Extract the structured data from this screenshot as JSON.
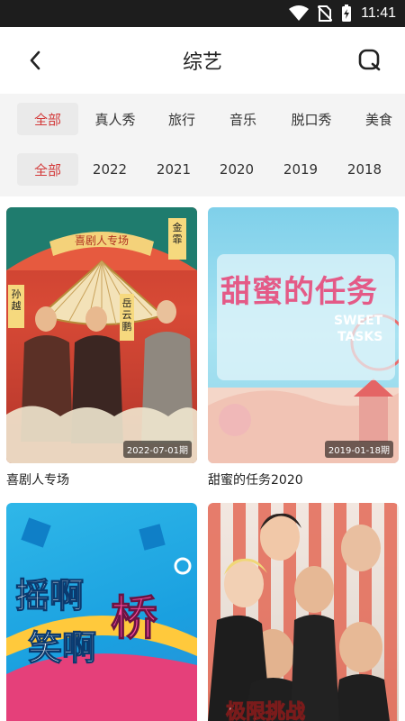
{
  "status": {
    "time": "11:41"
  },
  "header": {
    "title": "综艺"
  },
  "filters": {
    "categories": [
      "全部",
      "真人秀",
      "旅行",
      "音乐",
      "脱口秀",
      "美食"
    ],
    "years": [
      "全部",
      "2022",
      "2021",
      "2020",
      "2019",
      "2018"
    ]
  },
  "cards": [
    {
      "title": "喜剧人专场",
      "date": "2022-07-01期"
    },
    {
      "title": "甜蜜的任务2020",
      "date": "2019-01-18期"
    },
    {
      "title": "",
      "date": ""
    },
    {
      "title": "",
      "date": ""
    }
  ],
  "poster_text": {
    "card0_banner": "喜剧人专场",
    "card0_left_sign": "孙越",
    "card0_right_sign": "岳云鹏",
    "card0_top_right_sign": "金霏",
    "card1_cn": "甜蜜的任务",
    "card1_en_top": "SWEET",
    "card1_en_bottom": "TASKS",
    "card2_line1": "摇啊",
    "card2_line2": "笑啊",
    "card2_big": "桥",
    "card3_bottom": "极限挑战"
  },
  "colors": {
    "accent": "#d33a3a"
  }
}
